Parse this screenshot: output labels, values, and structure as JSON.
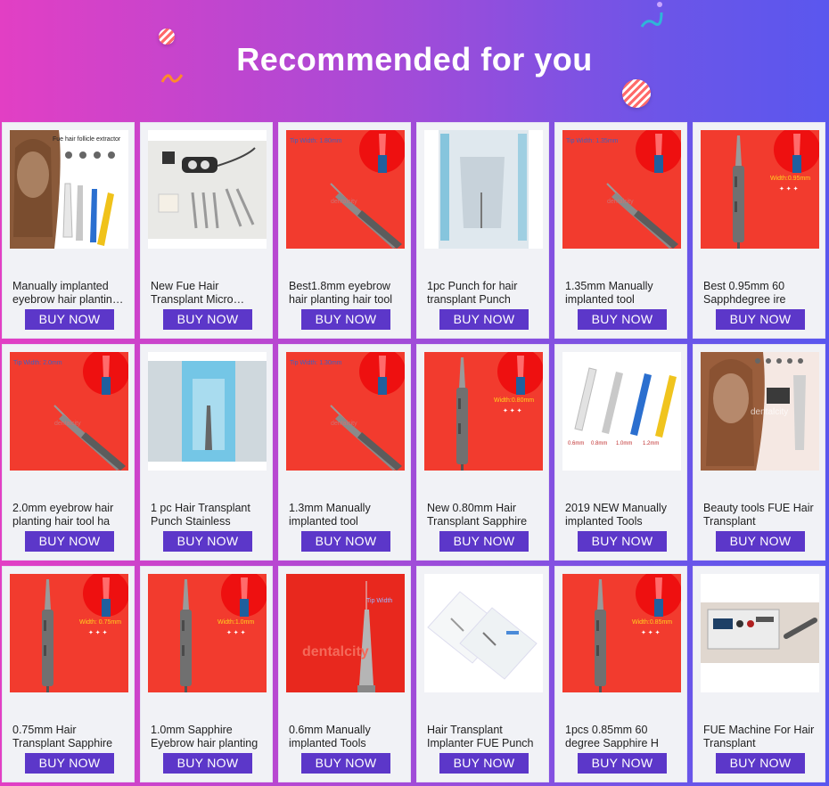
{
  "header": {
    "title": "Recommended for you"
  },
  "products": [
    {
      "name": "Manually implanted eyebrow hair planting hair tool",
      "button": "BUY NOW",
      "image": "woman-hair-extractor-tools",
      "overlay_text": "Fue hair follicle extractor"
    },
    {
      "name": "New Fue Hair Transplant Micro Motor",
      "button": "BUY NOW",
      "image": "motor-kit-with-punches"
    },
    {
      "name": "Best1.8mm eyebrow hair planting hair tool",
      "button": "BUY NOW",
      "image": "red-bg-implanter",
      "overlay_text": "Tip Width: 1.80mm"
    },
    {
      "name": "1pc Punch for hair transplant Punch",
      "button": "BUY NOW",
      "image": "sterile-pouch-punch"
    },
    {
      "name": "1.35mm Manually implanted tool",
      "button": "BUY NOW",
      "image": "red-bg-implanter",
      "overlay_text": "Tip Width: 1.35mm"
    },
    {
      "name": "Best 0.95mm 60 Sapphdegree ire",
      "button": "BUY NOW",
      "image": "red-bg-sapphire-pen",
      "overlay_text": "Width:0.95mm"
    },
    {
      "name": "2.0mm eyebrow hair planting hair tool ha",
      "button": "BUY NOW",
      "image": "red-bg-implanter",
      "overlay_text": "Tip Width: 2.0mm"
    },
    {
      "name": "1 pc Hair Transplant Punch Stainless",
      "button": "BUY NOW",
      "image": "blue-pouch-punch"
    },
    {
      "name": "1.3mm Manually implanted tool",
      "button": "BUY NOW",
      "image": "red-bg-implanter",
      "overlay_text": "Tip Width: 1.30mm"
    },
    {
      "name": "New 0.80mm Hair Transplant Sapphire",
      "button": "BUY NOW",
      "image": "red-bg-sapphire-pen",
      "overlay_text": "Width:0.80mm"
    },
    {
      "name": "2019 NEW Manually implanted Tools",
      "button": "BUY NOW",
      "image": "four-color-implanters",
      "sizes": [
        "0.6mm",
        "0.8mm",
        "1.0mm",
        "1.2mm"
      ]
    },
    {
      "name": "Beauty tools FUE Hair Transplant",
      "button": "BUY NOW",
      "image": "woman-hair-motor-pen"
    },
    {
      "name": "0.75mm Hair Transplant Sapphire",
      "button": "BUY NOW",
      "image": "red-bg-sapphire-pen",
      "overlay_text": "Width: 0.75mm"
    },
    {
      "name": "1.0mm Sapphire Eyebrow hair planting",
      "button": "BUY NOW",
      "image": "red-bg-sapphire-pen",
      "overlay_text": "Width:1.0mm"
    },
    {
      "name": "0.6mm Manually implanted Tools",
      "button": "BUY NOW",
      "image": "red-bg-long-pen",
      "overlay_text": "dentalcity"
    },
    {
      "name": "Hair Transplant Implanter FUE Punch",
      "button": "BUY NOW",
      "image": "white-boxes-packaging"
    },
    {
      "name": "1pcs 0.85mm 60 degree Sapphire H",
      "button": "BUY NOW",
      "image": "red-bg-sapphire-pen",
      "overlay_text": "Width:0.85mm"
    },
    {
      "name": "FUE Machine For Hair Transplant",
      "button": "BUY NOW",
      "image": "fue-machine-console"
    }
  ]
}
